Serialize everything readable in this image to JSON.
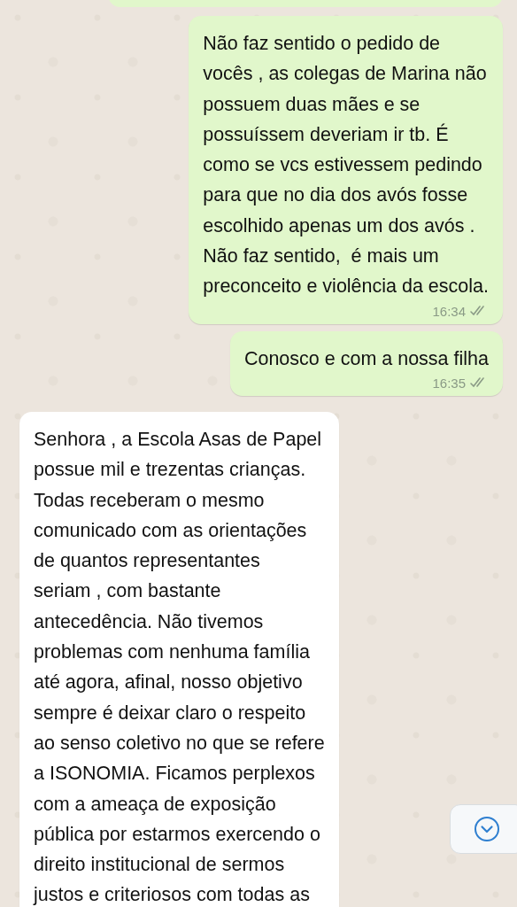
{
  "messages": [
    {
      "kind": "outgoing",
      "text": "Não faz sentido o pedido de\nvocês , as colegas de Marina não\npossuem duas mães e se\npossuíssem deveriam ir tb. É\ncomo se vcs estivessem pedindo\npara que no dia dos avós fosse\nescolhido apenas um dos avós .\nNão faz sentido,  é mais um\npreconceito e violência da escola.",
      "time": "16:34",
      "read": false
    },
    {
      "kind": "outgoing",
      "text": "Conosco e com a nossa filha",
      "time": "16:35",
      "read": false
    },
    {
      "kind": "incoming",
      "text": "Senhora , a Escola Asas de Papel\npossue mil e trezentas crianças.\nTodas receberam o mesmo\ncomunicado com as orientações\nde quantos representantes\nseriam , com bastante\nantecedência. Não tivemos\nproblemas com nenhuma família\naté agora, afinal, nosso objetivo\nsempre é deixar claro o respeito\nao senso coletivo no que se refere\na ISONOMIA. Ficamos perplexos\ncom a ameaça de exposição\npública por estarmos exercendo o\ndireito institucional de sermos\njustos e criteriosos com todas as"
    }
  ]
}
